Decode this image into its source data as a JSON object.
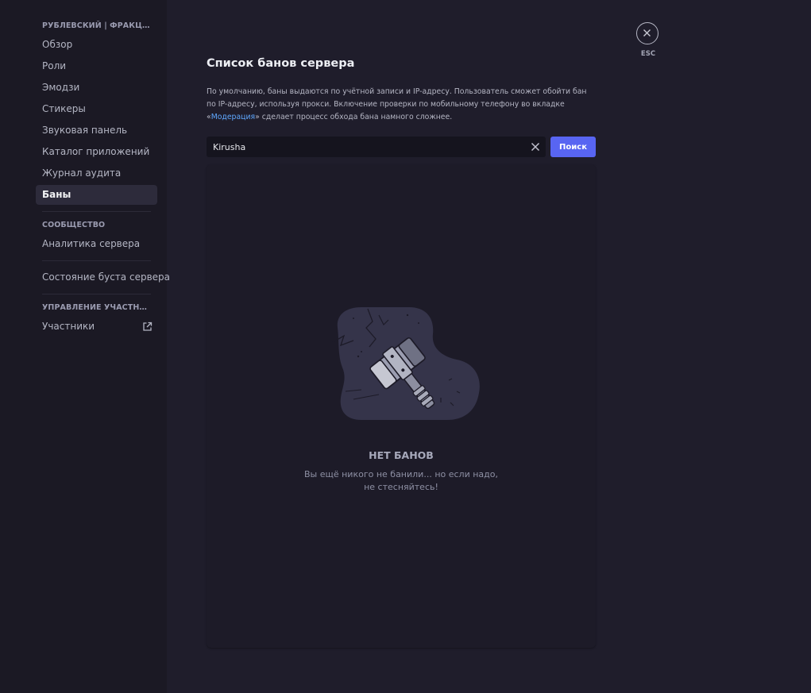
{
  "sidebar": {
    "server_header": "РУБЛЕВСКИЙ | ФРАКЦИИ",
    "server_items": [
      {
        "label": "Обзор"
      },
      {
        "label": "Роли"
      },
      {
        "label": "Эмодзи"
      },
      {
        "label": "Стикеры"
      },
      {
        "label": "Звуковая панель"
      },
      {
        "label": "Каталог приложений"
      },
      {
        "label": "Журнал аудита"
      },
      {
        "label": "Баны",
        "active": true
      }
    ],
    "community_header": "СООБЩЕСТВО",
    "community_items": [
      {
        "label": "Аналитика сервера"
      }
    ],
    "boost_item": "Состояние буста сервера",
    "members_header": "УПРАВЛЕНИЕ УЧАСТНИКА...",
    "members_items": [
      {
        "label": "Участники",
        "icon": "external-link-icon"
      }
    ]
  },
  "main": {
    "title": "Список банов сервера",
    "description_part1": "По умолчанию, баны выдаются по учётной записи и IP-адресу. Пользователь сможет обойти бан по IP-адресу, используя прокси. Включение проверки по мобильному телефону во вкладке «",
    "description_link": "Модерация",
    "description_part2": "» сделает процесс обхода бана намного сложнее.",
    "search": {
      "value": "Kirusha",
      "clear_icon": "close-icon",
      "button_label": "Поиск"
    },
    "empty_state": {
      "title": "НЕТ БАНОВ",
      "subtitle_line1": "Вы ещё никого не банили... но если надо,",
      "subtitle_line2": "не стесняйтесь!",
      "illustration_icon": "ban-hammer-illustration"
    }
  },
  "close": {
    "icon": "close-icon",
    "label": "ESC"
  },
  "colors": {
    "background": "#1f1d2b",
    "sidebar": "#1b1924",
    "accent": "#5865f2",
    "link": "#5fa8ff"
  }
}
